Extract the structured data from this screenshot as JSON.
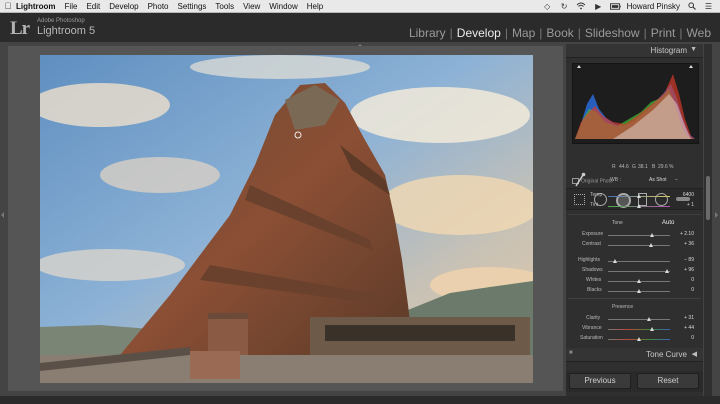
{
  "menubar": {
    "app": "Lightroom",
    "items": [
      "File",
      "Edit",
      "Develop",
      "Photo",
      "Settings",
      "Tools",
      "View",
      "Window",
      "Help"
    ],
    "user": "Howard Pinsky"
  },
  "identity": {
    "logo": "Lr",
    "vendor": "Adobe Photoshop",
    "product": "Lightroom 5"
  },
  "modules": [
    "Library",
    "Develop",
    "Map",
    "Book",
    "Slideshow",
    "Print",
    "Web"
  ],
  "active_module": "Develop",
  "histogram": {
    "title": "Histogram",
    "r_label": "R",
    "r_value": "44.6",
    "g_label": "G",
    "g_value": "38.1",
    "b_label": "B",
    "b_value": "29.6",
    "pct": "%",
    "original_label": "Original Photo"
  },
  "basic": {
    "wb_label": "WB :",
    "wb_value": "As Shot",
    "temp_label": "Temp",
    "temp_value": "6400",
    "tint_label": "Tint",
    "tint_value": "+ 1",
    "tone_label": "Tone",
    "auto_label": "Auto",
    "exposure_label": "Exposure",
    "exposure_value": "+ 2.10",
    "contrast_label": "Contrast",
    "contrast_value": "+ 36",
    "highlights_label": "Highlights",
    "highlights_value": "− 89",
    "shadows_label": "Shadows",
    "shadows_value": "+ 96",
    "whites_label": "Whites",
    "whites_value": "0",
    "blacks_label": "Blacks",
    "blacks_value": "0",
    "presence_label": "Presence",
    "clarity_label": "Clarity",
    "clarity_value": "+ 31",
    "vibrance_label": "Vibrance",
    "vibrance_value": "+ 44",
    "saturation_label": "Saturation",
    "saturation_value": "0"
  },
  "tone_curve": {
    "title": "Tone Curve"
  },
  "buttons": {
    "previous": "Previous",
    "reset": "Reset"
  },
  "icons": [
    "apple-icon",
    "dropbox-icon",
    "sync-icon",
    "wifi-icon",
    "volume-icon",
    "battery-icon",
    "search-icon",
    "list-icon",
    "crop-icon",
    "spot-removal-icon",
    "red-eye-icon",
    "graduated-filter-icon",
    "radial-filter-icon",
    "adjustment-brush-icon",
    "eyedropper-icon"
  ]
}
